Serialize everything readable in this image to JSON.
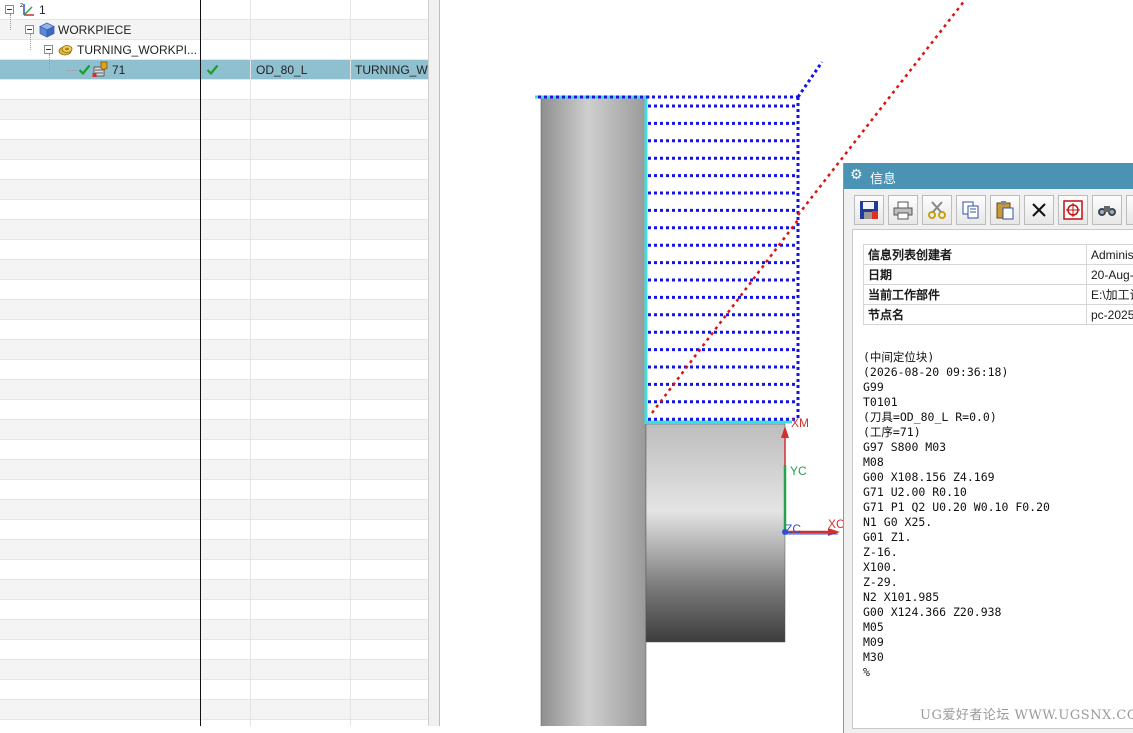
{
  "navigator": {
    "tree": [
      {
        "label": "1",
        "icon": "machine-axes-icon"
      },
      {
        "label": "WORKPIECE",
        "icon": "workpiece-cube-icon"
      },
      {
        "label": "TURNING_WORKPI...",
        "icon": "turning-workpiece-icon"
      },
      {
        "label": "71",
        "icon": "operation-icon",
        "status": "complete",
        "tool": "OD_80_L",
        "geometry": "TURNING_W"
      }
    ]
  },
  "graphics": {
    "axis_labels": {
      "xm": "XM",
      "yc": "YC",
      "zc": "ZC",
      "xc": "XC"
    },
    "colors": {
      "toolpath": "#1414e6",
      "rapid": "#e01010",
      "highlight": "#3de0e0",
      "xaxis": "#d23030",
      "yaxis": "#2aa04a",
      "zaxis": "#3050d0"
    }
  },
  "info_window": {
    "title": "信息",
    "toolbar_icons": [
      "save-icon",
      "print-icon",
      "cut-icon",
      "copy-icon",
      "paste-icon",
      "delete-icon",
      "target-icon",
      "find-icon"
    ],
    "meta": [
      {
        "key": "信息列表创建者",
        "value": "Adminis"
      },
      {
        "key": "日期",
        "value": "20-Aug-"
      },
      {
        "key": "当前工作部件",
        "value": "E:\\加工设"
      },
      {
        "key": "节点名",
        "value": "pc-2025"
      }
    ],
    "nc_lines": [
      "(中间定位块)",
      "(2026-08-20 09:36:18)",
      "G99",
      "T0101",
      "(刀具=OD_80_L R=0.0)",
      "(工序=71)",
      "G97 S800 M03",
      "M08",
      "G00 X108.156 Z4.169",
      "G71 U2.00 R0.10",
      "G71 P1 Q2 U0.20 W0.10 F0.20",
      "N1 G0 X25.",
      "G01 Z1.",
      "Z-16.",
      "X100.",
      "Z-29.",
      "N2 X101.985",
      "G00 X124.366 Z20.938",
      "M05",
      "M09",
      "M30",
      "%"
    ]
  },
  "watermark": "UG爱好者论坛 WWW.UGSNX.COM"
}
